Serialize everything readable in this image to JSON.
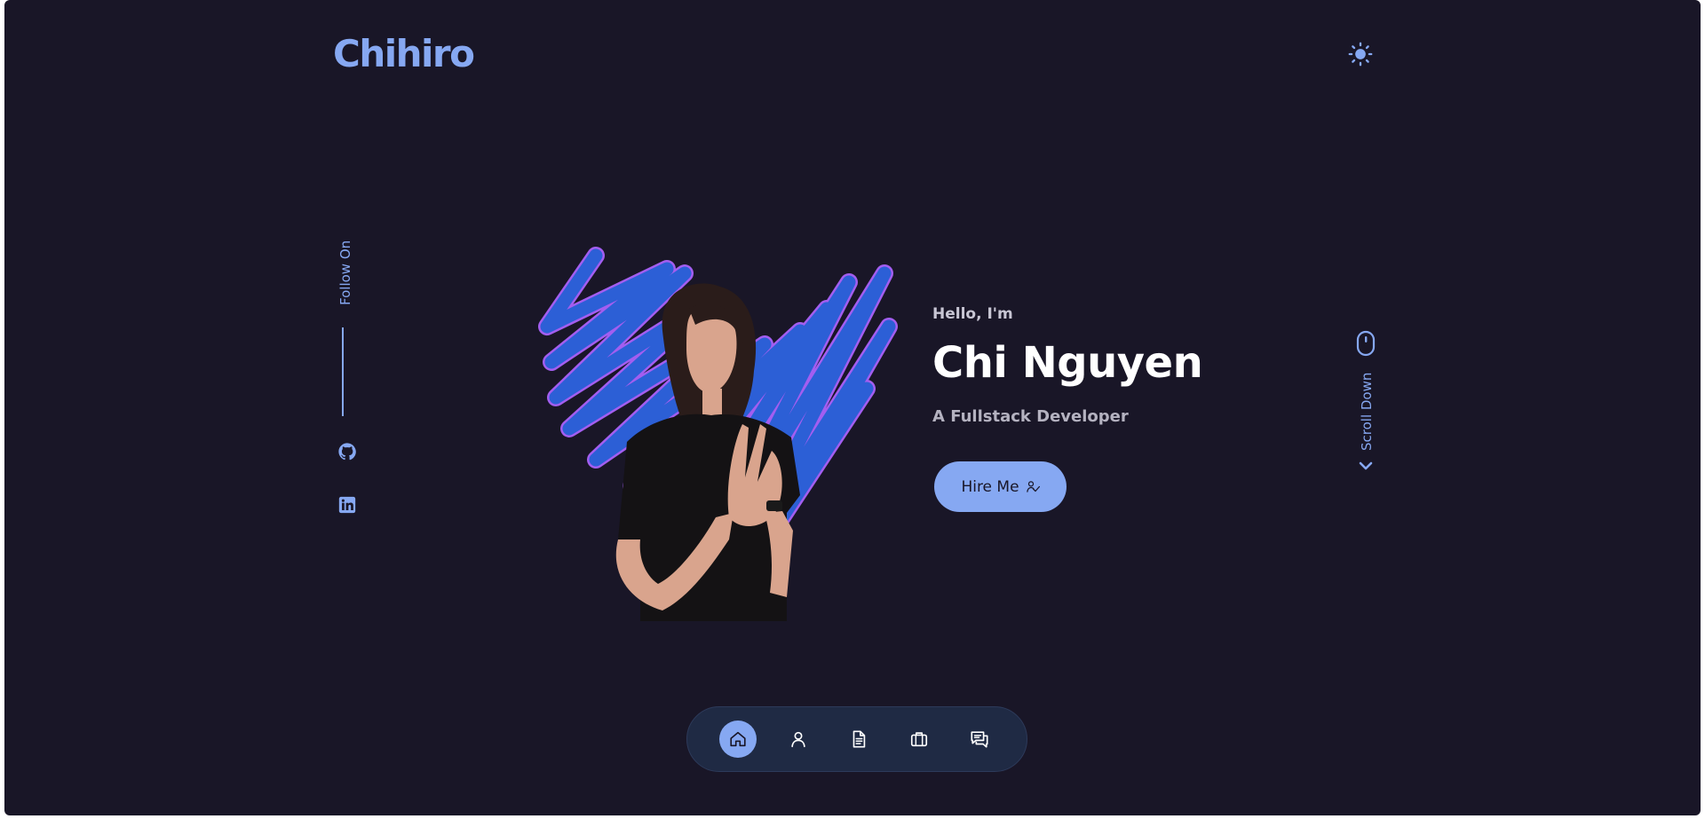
{
  "header": {
    "logo": "Chihiro",
    "theme_icon": "sun-icon"
  },
  "social": {
    "label": "Follow On",
    "links": [
      {
        "name": "github",
        "icon": "github-icon"
      },
      {
        "name": "linkedin",
        "icon": "linkedin-icon"
      }
    ]
  },
  "hero": {
    "greeting": "Hello, I'm",
    "name": "Chi Nguyen",
    "title": "A Fullstack Developer",
    "cta_label": "Hire Me",
    "cta_icon": "hire-icon",
    "image_description_icon": "profile-photo"
  },
  "scroll": {
    "label": "Scroll Down",
    "icon": "mouse-icon",
    "chevron_icon": "chevron-down-icon"
  },
  "nav": {
    "items": [
      {
        "name": "home",
        "icon": "home-icon",
        "active": true
      },
      {
        "name": "about",
        "icon": "user-icon",
        "active": false
      },
      {
        "name": "resume",
        "icon": "document-icon",
        "active": false
      },
      {
        "name": "portfolio",
        "icon": "briefcase-icon",
        "active": false
      },
      {
        "name": "contact",
        "icon": "chat-icon",
        "active": false
      }
    ]
  },
  "colors": {
    "background": "#191627",
    "accent": "#86a8f2",
    "heading": "#ffffff",
    "scribble": "#2c5fd6",
    "scribble_edge": "#a35ef0",
    "nav_bg": "#1f2a44"
  }
}
